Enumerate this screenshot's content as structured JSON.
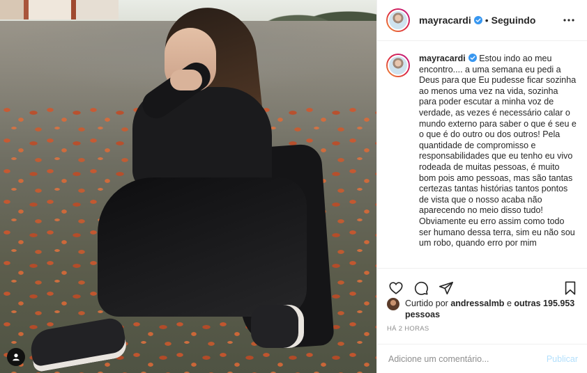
{
  "post": {
    "username": "mayracardi",
    "separator": "•",
    "follow_status": "Seguindo"
  },
  "caption": {
    "username": "mayracardi",
    "text": "Estou indo ao meu encontro.... a uma semana eu pedi a Deus para que Eu pudesse ficar sozinha ao menos uma vez na vida, sozinha para poder escutar a minha voz de verdade, as vezes é necessário calar o mundo externo para saber o que é seu e o que é do outro ou dos outros! Pela quantidade de compromisso e responsabilidades que eu tenho eu vivo rodeada de muitas pessoas, é muito bom pois amo pessoas, mas são tantas certezas tantas histórias tantos pontos de vista que o nosso acaba não aparecendo no meio disso tudo!",
    "text_2": "Obviamente eu erro assim como todo ser humano dessa terra, sim eu não sou um robo, quando erro por mim"
  },
  "likes": {
    "prefix": "Curtido por",
    "liker": "andressalmb",
    "middle": "e",
    "others": "outras 195.953 pessoas"
  },
  "timestamp": "Há 2 horas",
  "comment_box": {
    "placeholder": "Adicione um comentário...",
    "post_label": "Publicar"
  },
  "colors": {
    "verified": "#3897f0",
    "publish_disabled": "#b2dffc",
    "muted_text": "#8e8e8e"
  },
  "icons": {
    "like": "heart-icon",
    "comment": "comment-bubble-icon",
    "share": "paper-plane-icon",
    "save": "bookmark-icon",
    "more": "more-horizontal-icon",
    "tagged": "user-tag-icon"
  }
}
